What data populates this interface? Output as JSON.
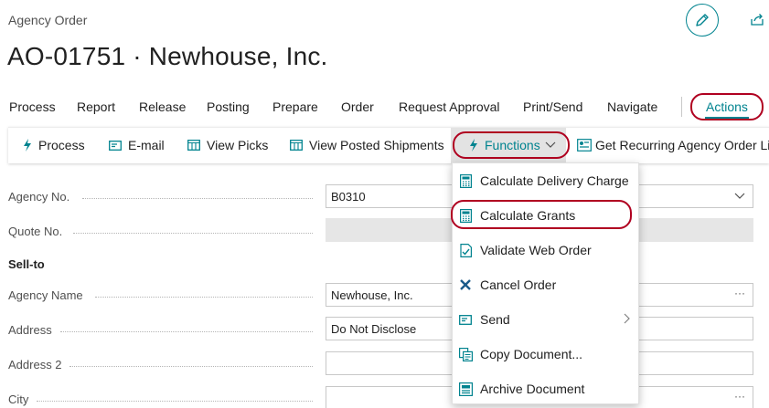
{
  "header": {
    "caption": "Agency Order",
    "title": "AO-01751 · Newhouse, Inc."
  },
  "menubar": {
    "items": [
      "Process",
      "Report",
      "Release",
      "Posting",
      "Prepare",
      "Order",
      "Request Approval",
      "Print/Send",
      "Navigate"
    ],
    "active": "Actions"
  },
  "toolbar": {
    "process": "Process",
    "email": "E-mail",
    "view_picks": "View Picks",
    "view_posted": "View Posted Shipments",
    "functions": "Functions",
    "recurring": "Get Recurring Agency Order Lin"
  },
  "form": {
    "agency_no_label": "Agency No.",
    "agency_no_value": "B0310",
    "quote_no_label": "Quote No.",
    "sell_to_heading": "Sell-to",
    "agency_name_label": "Agency Name",
    "agency_name_value": "Newhouse, Inc.",
    "address_label": "Address",
    "address_value": "Do Not Disclose",
    "address2_label": "Address 2",
    "city_label": "City"
  },
  "functions_menu": {
    "items": [
      {
        "label": "Calculate Delivery Charge",
        "icon": "calculator-icon"
      },
      {
        "label": "Calculate Grants",
        "icon": "calculator-icon"
      },
      {
        "label": "Validate Web Order",
        "icon": "validate-document-icon"
      },
      {
        "label": "Cancel Order",
        "icon": "cross-icon"
      },
      {
        "label": "Send",
        "icon": "send-icon"
      },
      {
        "label": "Copy Document...",
        "icon": "copy-document-icon"
      },
      {
        "label": "Archive Document",
        "icon": "archive-icon"
      }
    ]
  },
  "colors": {
    "accent": "#00838f",
    "highlight": "#b00020"
  }
}
